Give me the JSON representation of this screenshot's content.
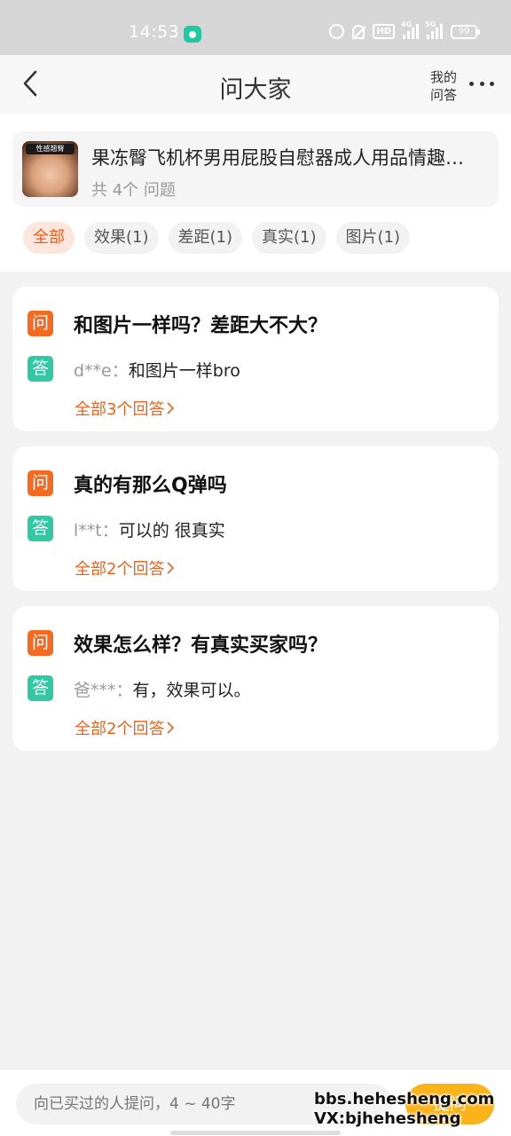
{
  "status_bar": {
    "time": "14:53",
    "battery": "99",
    "hd": "HD",
    "net1": "4G",
    "net2": "5G"
  },
  "nav": {
    "title": "问大家",
    "my_qa": "我的问答"
  },
  "product": {
    "name": "果冻臀飞机杯男用屁股自慰器成人用品情趣用品",
    "thumb_label": "性感翘臀",
    "question_count": "共 4个 问题"
  },
  "filters": [
    {
      "label": "全部",
      "active": true
    },
    {
      "label": "效果(1)",
      "active": false
    },
    {
      "label": "差距(1)",
      "active": false
    },
    {
      "label": "真实(1)",
      "active": false
    },
    {
      "label": "图片(1)",
      "active": false
    }
  ],
  "badges": {
    "question": "问",
    "answer": "答"
  },
  "qa": [
    {
      "question": "和图片一样吗？差距大不大？",
      "user": "d**e：",
      "answer": "和图片一样bro",
      "all_answers": "全部3个回答"
    },
    {
      "question": "真的有那么Q弹吗",
      "user": "l**t：",
      "answer": "可以的 很真实",
      "all_answers": "全部2个回答"
    },
    {
      "question": "效果怎么样？有真实买家吗？",
      "user": "爸***：",
      "answer": "有，效果可以。",
      "all_answers": "全部2个回答"
    }
  ],
  "bottom": {
    "placeholder": "向已买过的人提问，4 ~ 40字",
    "ask_button": "提问"
  },
  "watermark": {
    "line1": "bbs.hehesheng.com",
    "line2": "VX:bjhehesheng"
  },
  "colors": {
    "accent": "#f05a1a",
    "question_badge": "#f56a21",
    "answer_badge": "#31c8a4",
    "ask_button": "#fbb31a"
  }
}
